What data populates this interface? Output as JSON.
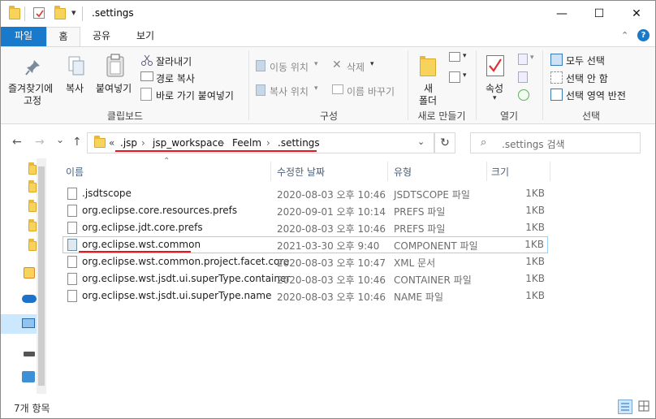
{
  "window": {
    "title": ".settings",
    "minimize": "—",
    "maximize": "☐",
    "close": "✕"
  },
  "tabs": [
    {
      "label": "파일"
    },
    {
      "label": "홈"
    },
    {
      "label": "공유"
    },
    {
      "label": "보기"
    }
  ],
  "ribbon": {
    "clipboard": {
      "pin_label": "즐겨찾기에",
      "pin_label2": "고정",
      "copy": "복사",
      "paste": "붙여넣기",
      "cut": "잘라내기",
      "copy_path": "경로 복사",
      "paste_shortcut": "바로 가기 붙여넣기",
      "group": "클립보드"
    },
    "organize": {
      "move_to": "이동 위치",
      "delete": "삭제",
      "copy_to": "복사 위치",
      "rename": "이름 바꾸기",
      "group": "구성"
    },
    "new": {
      "new_folder": "새",
      "new_folder2": "폴더",
      "group": "새로 만들기"
    },
    "open": {
      "properties": "속성",
      "group": "열기"
    },
    "select": {
      "select_all": "모두 선택",
      "select_none": "선택 안 함",
      "invert": "선택 영역 반전",
      "group": "선택"
    }
  },
  "nav": {
    "back": "←",
    "forward": "→",
    "history": "⌄",
    "up": "↑",
    "refresh": "↻"
  },
  "address": {
    "overflow": "«",
    "crumbs": [
      ".jsp",
      "jsp_workspace",
      "Feelm",
      ".settings"
    ],
    "sep": "›"
  },
  "search": {
    "placeholder": ".settings 검색"
  },
  "columns": {
    "name": "이름",
    "modified": "수정한 날짜",
    "type": "유형",
    "size": "크기"
  },
  "files": [
    {
      "name": ".jsdtscope",
      "modified": "2020-08-03 오후 10:46",
      "type": "JSDTSCOPE 파일",
      "size": "1KB"
    },
    {
      "name": "org.eclipse.core.resources.prefs",
      "modified": "2020-09-01 오후 10:14",
      "type": "PREFS 파일",
      "size": "1KB"
    },
    {
      "name": "org.eclipse.jdt.core.prefs",
      "modified": "2020-08-03 오후 10:46",
      "type": "PREFS 파일",
      "size": "1KB"
    },
    {
      "name": "org.eclipse.wst.common",
      "modified": "2021-03-30 오후 9:40",
      "type": "COMPONENT 파일",
      "size": "1KB"
    },
    {
      "name": "org.eclipse.wst.common.project.facet.core",
      "modified": "2020-08-03 오후 10:47",
      "type": "XML 문서",
      "size": "1KB"
    },
    {
      "name": "org.eclipse.wst.jsdt.ui.superType.container",
      "modified": "2020-08-03 오후 10:46",
      "type": "CONTAINER 파일",
      "size": "1KB"
    },
    {
      "name": "org.eclipse.wst.jsdt.ui.superType.name",
      "modified": "2020-08-03 오후 10:46",
      "type": "NAME 파일",
      "size": "1KB"
    }
  ],
  "status": {
    "count": "7개 항목"
  },
  "colors": {
    "file_tab": "#1979ca",
    "annotation": "#e8151f",
    "selection_border": "#99d1ff"
  }
}
